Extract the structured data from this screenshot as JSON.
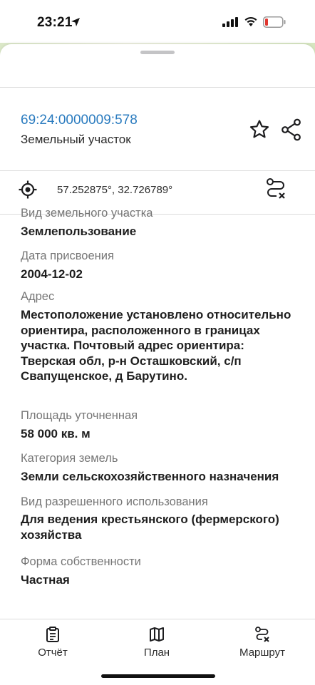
{
  "status_bar": {
    "time": "23:21"
  },
  "header": {
    "cadastral_number": "69:24:0000009:578",
    "object_type": "Земельный участок"
  },
  "location": {
    "coordinates": "57.252875°, 32.726789°"
  },
  "fields": [
    {
      "label": "Вид земельного участка",
      "value": "Землепользование"
    },
    {
      "label": "Дата присвоения",
      "value": "2004-12-02"
    },
    {
      "label": "Адрес",
      "value": "Местоположение установлено относительно ориентира, расположенного в границах участка. Почтовый адрес ориентира: Тверская обл, р-н Осташковский, с/п Свапущенское, д Барутино."
    },
    {
      "label": "Площадь уточненная",
      "value": "58 000 кв. м"
    },
    {
      "label": "Категория земель",
      "value": "Земли сельскохозяйственного назначения"
    },
    {
      "label": "Вид разрешенного использования",
      "value": "Для ведения крестьянского (фермерского) хозяйства"
    },
    {
      "label": "Форма собственности",
      "value": "Частная"
    }
  ],
  "tabs": [
    {
      "label": "Отчёт",
      "icon": "report-icon"
    },
    {
      "label": "План",
      "icon": "map-icon"
    },
    {
      "label": "Маршрут",
      "icon": "route-icon"
    }
  ],
  "colors": {
    "accent": "#2a7bbf",
    "label_gray": "#767676",
    "value_text": "#1f1f1f",
    "battery_low": "#e0362f"
  }
}
